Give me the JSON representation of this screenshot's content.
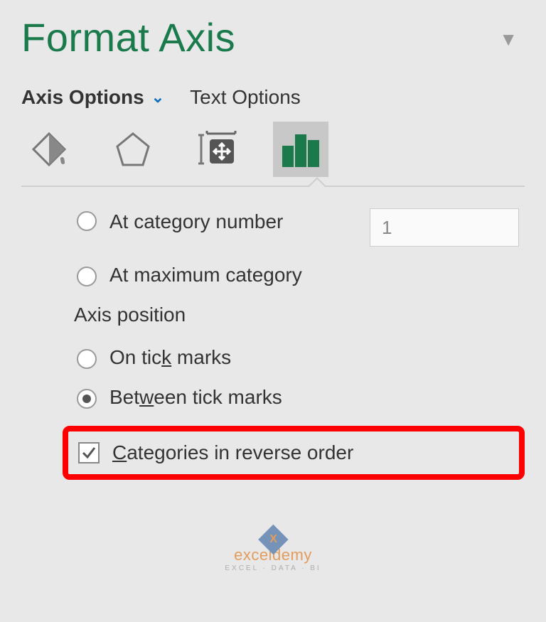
{
  "title": "Format Axis",
  "tabs": {
    "axis_options": "Axis Options",
    "text_options": "Text Options"
  },
  "icons": {
    "fill": "fill-line-icon",
    "effects": "effects-icon",
    "size": "size-properties-icon",
    "axis": "axis-options-icon"
  },
  "crosses": {
    "at_category_number": {
      "pre": "At cate",
      "ul": "g",
      "post": "ory number"
    },
    "value": "1",
    "at_maximum": {
      "pre": "At maximum cate",
      "ul": "g",
      "post": "ory"
    }
  },
  "axis_position_label": "Axis position",
  "axis_position": {
    "on_tick": {
      "pre": "On tic",
      "ul": "k",
      "post": " marks"
    },
    "between_tick": {
      "pre": "Bet",
      "ul": "w",
      "post": "een tick marks"
    },
    "selected": "between"
  },
  "reverse": {
    "ul": "C",
    "post": "ategories in reverse order",
    "checked": true
  },
  "watermark": {
    "name": "exceldemy",
    "sub": "EXCEL · DATA · BI"
  }
}
